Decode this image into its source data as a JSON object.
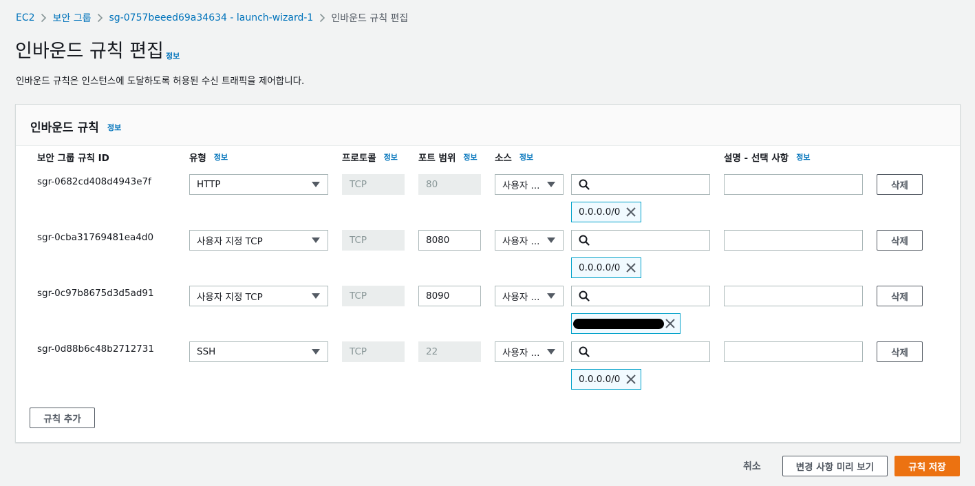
{
  "breadcrumb": {
    "items": [
      "EC2",
      "보안 그룹",
      "sg-0757beeed69a34634 - launch-wizard-1"
    ],
    "current": "인바운드 규칙 편집"
  },
  "page": {
    "title": "인바운드 규칙 편집",
    "info": "정보",
    "description": "인바운드 규칙은 인스턴스에 도달하도록 허용된 수신 트래픽을 제어합니다."
  },
  "panel": {
    "title": "인바운드 규칙",
    "info": "정보",
    "columns": {
      "rule_id": "보안 그룹 규칙 ID",
      "type": "유형",
      "protocol": "프로토콜",
      "port_range": "포트 범위",
      "source": "소스",
      "description": "설명 - 선택 사항",
      "info": "정보"
    },
    "rows": [
      {
        "id": "sgr-0682cd408d4943e7f",
        "type": "HTTP",
        "protocol": "TCP",
        "port": "80",
        "source_type": "사용자 ...",
        "cidr": "0.0.0.0/0",
        "delete_label": "삭제"
      },
      {
        "id": "sgr-0cba31769481ea4d0",
        "type": "사용자 지정 TCP",
        "protocol": "TCP",
        "port": "8080",
        "source_type": "사용자 ...",
        "cidr": "0.0.0.0/0",
        "delete_label": "삭제"
      },
      {
        "id": "sgr-0c97b8675d3d5ad91",
        "type": "사용자 지정 TCP",
        "protocol": "TCP",
        "port": "8090",
        "source_type": "사용자 ...",
        "cidr": "",
        "delete_label": "삭제"
      },
      {
        "id": "sgr-0d88b6c48b2712731",
        "type": "SSH",
        "protocol": "TCP",
        "port": "22",
        "source_type": "사용자 ...",
        "cidr": "0.0.0.0/0",
        "delete_label": "삭제"
      }
    ],
    "add_rule_label": "규칙 추가"
  },
  "footer": {
    "cancel_label": "취소",
    "preview_label": "변경 사항 미리 보기",
    "save_label": "규칙 저장"
  },
  "colors": {
    "link": "#0073bb",
    "primary": "#ec7211",
    "token_border": "#00a1c9",
    "token_bg": "#f1faff"
  },
  "icons": [
    "chevron-right-icon",
    "caret-down-icon",
    "search-icon",
    "close-icon"
  ]
}
